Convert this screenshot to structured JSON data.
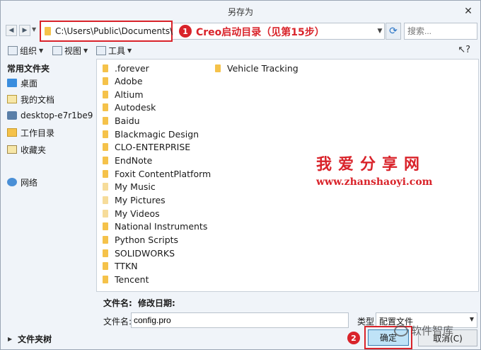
{
  "window": {
    "title": "另存为"
  },
  "nav": {
    "address_path": "C:\\Users\\Public\\Documents\\",
    "search_placeholder": "搜索..."
  },
  "annotations": {
    "step1_number": "1",
    "step1_text": "Creo启动目录（见第15步）",
    "step2_number": "2"
  },
  "toolbar": {
    "organize_label": "组织",
    "view_label": "视图",
    "tools_label": "工具"
  },
  "sidebar": {
    "header": "常用文件夹",
    "items": [
      {
        "label": "桌面",
        "icon": "desktop-icon"
      },
      {
        "label": "我的文档",
        "icon": "documents-icon"
      },
      {
        "label": "desktop-e7r1be9",
        "icon": "computer-icon"
      },
      {
        "label": "工作目录",
        "icon": "working-dir-icon"
      },
      {
        "label": "收藏夹",
        "icon": "favorites-icon"
      },
      {
        "label": "网络",
        "icon": "network-icon"
      }
    ],
    "folder_tree_label": "文件夹树"
  },
  "files": {
    "column1": [
      ".forever",
      "Adobe",
      "Altium",
      "Autodesk",
      "Baidu",
      "Blackmagic Design",
      "CLO-ENTERPRISE",
      "EndNote",
      "Foxit ContentPlatform",
      "My Music",
      "My Pictures",
      "My Videos",
      "National Instruments",
      "Python Scripts",
      "SOLIDWORKS",
      "TTKN",
      "Tencent"
    ],
    "column2": [
      "Vehicle Tracking"
    ],
    "faint_items": [
      "My Music",
      "My Pictures",
      "My Videos"
    ]
  },
  "watermark": {
    "site_name": "我爱分享网",
    "site_url": "www.zhanshaoyi.com",
    "wechat_name": "软件智库"
  },
  "bottom": {
    "info_filename_label": "文件名:",
    "info_modified_label": "修改日期:",
    "filename_label": "文件名:",
    "filename_value": "config.pro",
    "type_label": "类型",
    "type_value": "配置文件",
    "ok_label": "确定",
    "cancel_label": "取消(C)"
  },
  "colors": {
    "annotation_red": "#d9232a",
    "folder_yellow": "#f5c24a",
    "ok_button_blue": "#bfe3f7"
  }
}
